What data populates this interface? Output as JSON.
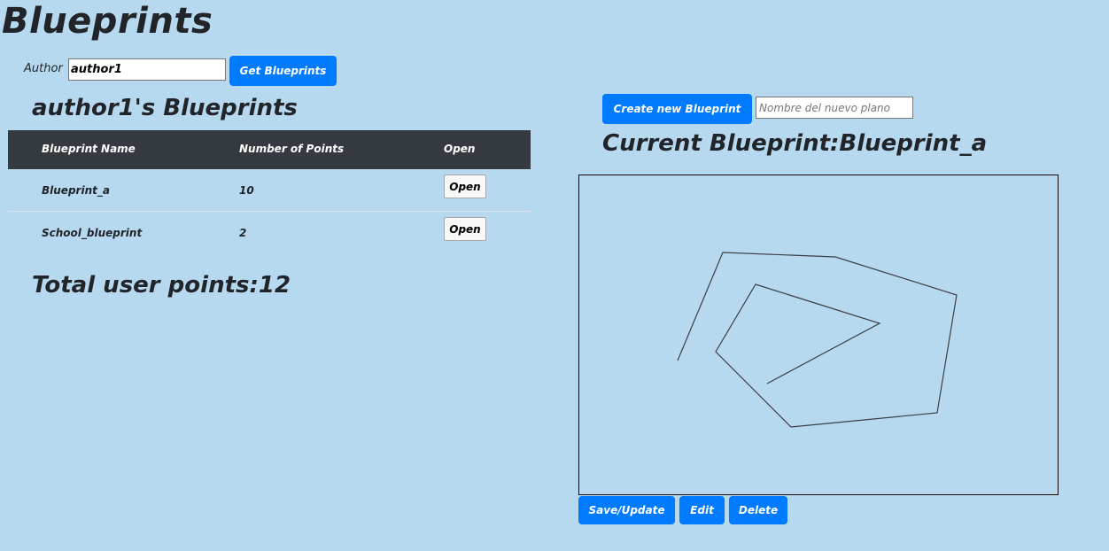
{
  "app": {
    "title": "Blueprints"
  },
  "author": {
    "label": "Author",
    "value": "author1",
    "get_button": "Get Blueprints"
  },
  "list": {
    "heading": "author1's Blueprints",
    "columns": [
      "Blueprint Name",
      "Number of Points",
      "Open"
    ],
    "rows": [
      {
        "name": "Blueprint_a",
        "points": "10",
        "action": "Open"
      },
      {
        "name": "School_blueprint",
        "points": "2",
        "action": "Open"
      }
    ],
    "total_label": "Total user points:",
    "total_value": "12"
  },
  "editor": {
    "create_button": "Create new Blueprint",
    "new_name_placeholder": "Nombre del nuevo plano",
    "current_label": "Current Blueprint:",
    "current_name": "Blueprint_a",
    "save_button": "Save/Update",
    "edit_button": "Edit",
    "delete_button": "Delete"
  },
  "colors": {
    "background": "#b7d9f0",
    "primary": "#007bff",
    "table_header": "#343a40",
    "stroke": "#3a3f44"
  }
}
